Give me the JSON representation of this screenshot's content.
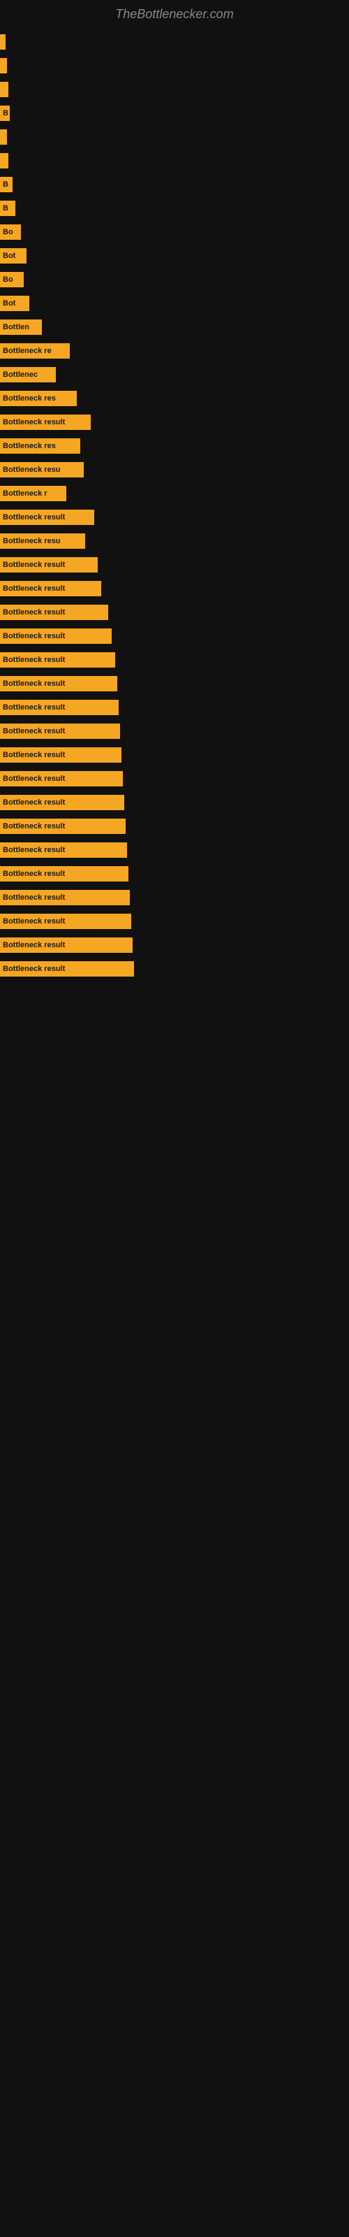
{
  "site": {
    "title": "TheBottlenecker.com"
  },
  "bars": [
    {
      "label": "",
      "width": 8
    },
    {
      "label": "",
      "width": 10
    },
    {
      "label": "",
      "width": 12
    },
    {
      "label": "B",
      "width": 14
    },
    {
      "label": "",
      "width": 10
    },
    {
      "label": "",
      "width": 12
    },
    {
      "label": "B",
      "width": 18
    },
    {
      "label": "B",
      "width": 22
    },
    {
      "label": "Bo",
      "width": 30
    },
    {
      "label": "Bot",
      "width": 38
    },
    {
      "label": "Bo",
      "width": 34
    },
    {
      "label": "Bot",
      "width": 42
    },
    {
      "label": "Bottlen",
      "width": 60
    },
    {
      "label": "Bottleneck re",
      "width": 100
    },
    {
      "label": "Bottlenec",
      "width": 80
    },
    {
      "label": "Bottleneck res",
      "width": 110
    },
    {
      "label": "Bottleneck result",
      "width": 130
    },
    {
      "label": "Bottleneck res",
      "width": 115
    },
    {
      "label": "Bottleneck resu",
      "width": 120
    },
    {
      "label": "Bottleneck r",
      "width": 95
    },
    {
      "label": "Bottleneck result",
      "width": 135
    },
    {
      "label": "Bottleneck resu",
      "width": 122
    },
    {
      "label": "Bottleneck result",
      "width": 140
    },
    {
      "label": "Bottleneck result",
      "width": 145
    },
    {
      "label": "Bottleneck result",
      "width": 155
    },
    {
      "label": "Bottleneck result",
      "width": 160
    },
    {
      "label": "Bottleneck result",
      "width": 165
    },
    {
      "label": "Bottleneck result",
      "width": 168
    },
    {
      "label": "Bottleneck result",
      "width": 170
    },
    {
      "label": "Bottleneck result",
      "width": 172
    },
    {
      "label": "Bottleneck result",
      "width": 174
    },
    {
      "label": "Bottleneck result",
      "width": 176
    },
    {
      "label": "Bottleneck result",
      "width": 178
    },
    {
      "label": "Bottleneck result",
      "width": 180
    },
    {
      "label": "Bottleneck result",
      "width": 182
    },
    {
      "label": "Bottleneck result",
      "width": 184
    },
    {
      "label": "Bottleneck result",
      "width": 186
    },
    {
      "label": "Bottleneck result",
      "width": 188
    },
    {
      "label": "Bottleneck result",
      "width": 190
    },
    {
      "label": "Bottleneck result",
      "width": 192
    }
  ]
}
